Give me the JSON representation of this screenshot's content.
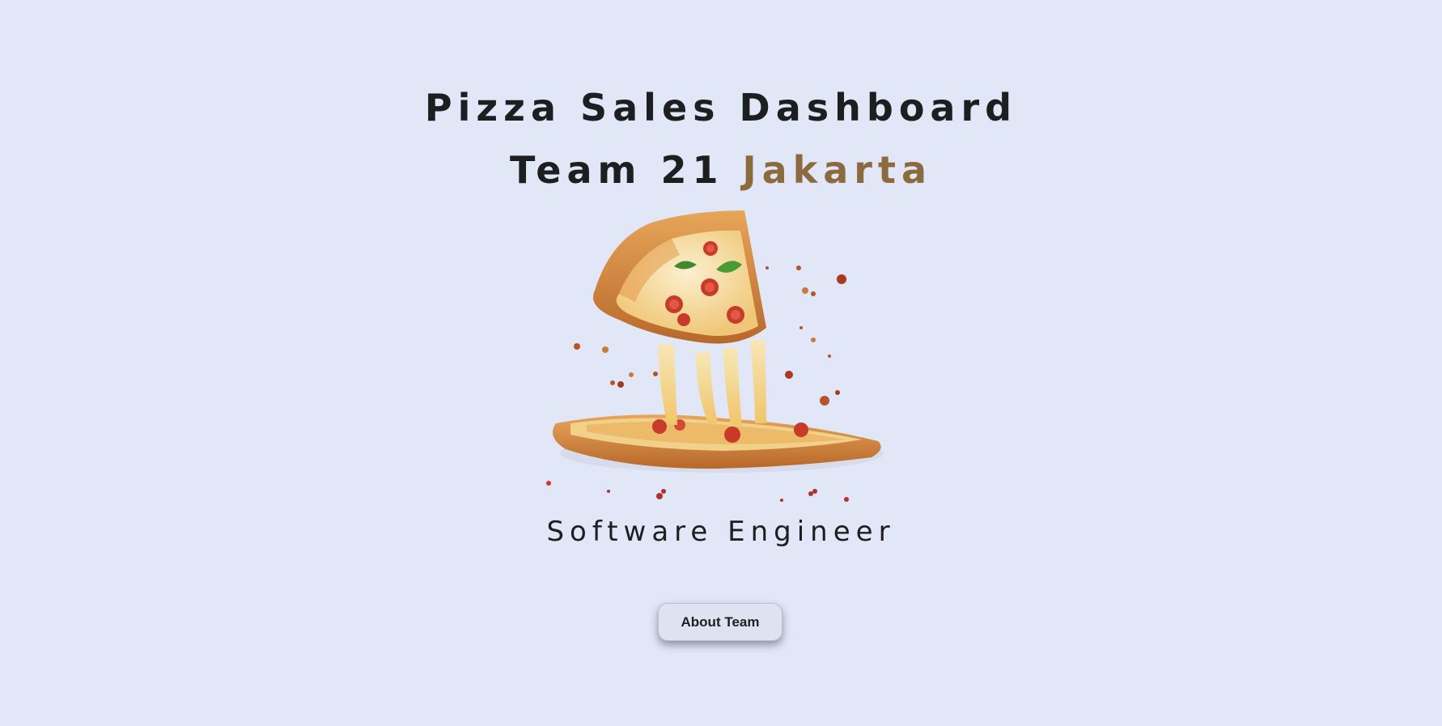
{
  "hero": {
    "title_line1": "Pizza Sales Dashboard",
    "title_line2_prefix": "Team 21 ",
    "title_line2_accent": "Jakarta",
    "subtitle": "Software Engineer",
    "button_label": "About Team"
  },
  "colors": {
    "background": "#e1e7f6",
    "text": "#1d1e20",
    "accent": "#8b6a3e"
  },
  "image": {
    "icon": "pizza-slice-illustration"
  }
}
